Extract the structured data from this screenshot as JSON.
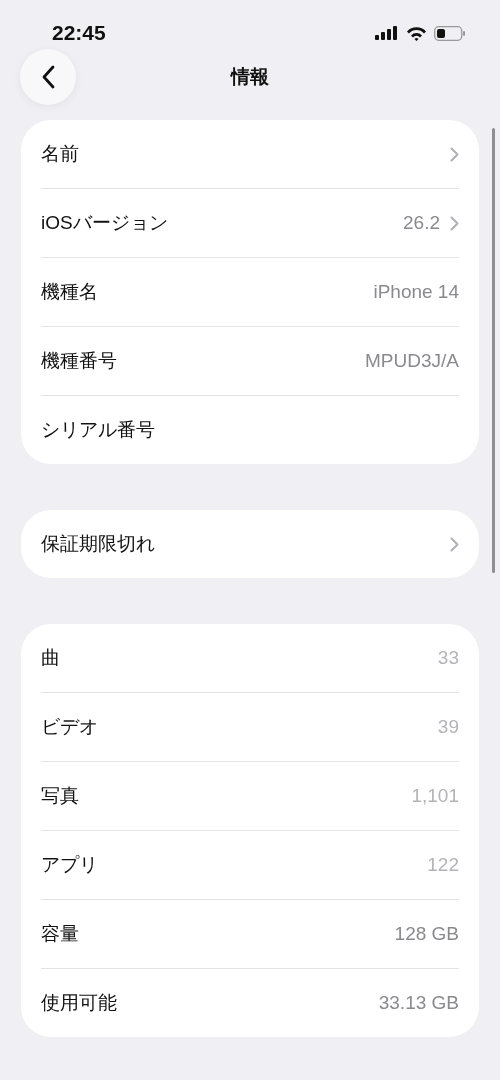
{
  "status_bar": {
    "time": "22:45"
  },
  "nav": {
    "title": "情報"
  },
  "sections": [
    {
      "rows": [
        {
          "label": "名前",
          "chevron": true
        },
        {
          "label": "iOSバージョン",
          "value": "26.2",
          "chevron": true,
          "dim": false
        },
        {
          "label": "機種名",
          "value": "iPhone 14",
          "dim": false
        },
        {
          "label": "機種番号",
          "value": "MPUD3J/A",
          "dim": false
        },
        {
          "label": "シリアル番号"
        }
      ]
    },
    {
      "rows": [
        {
          "label": "保証期限切れ",
          "chevron": true
        }
      ]
    },
    {
      "rows": [
        {
          "label": "曲",
          "value": "33",
          "dim": true
        },
        {
          "label": "ビデオ",
          "value": "39",
          "dim": true
        },
        {
          "label": "写真",
          "value": "1,101",
          "dim": true
        },
        {
          "label": "アプリ",
          "value": "122",
          "dim": true
        },
        {
          "label": "容量",
          "value": "128 GB",
          "dim": false
        },
        {
          "label": "使用可能",
          "value": "33.13 GB",
          "dim": false
        }
      ]
    }
  ]
}
